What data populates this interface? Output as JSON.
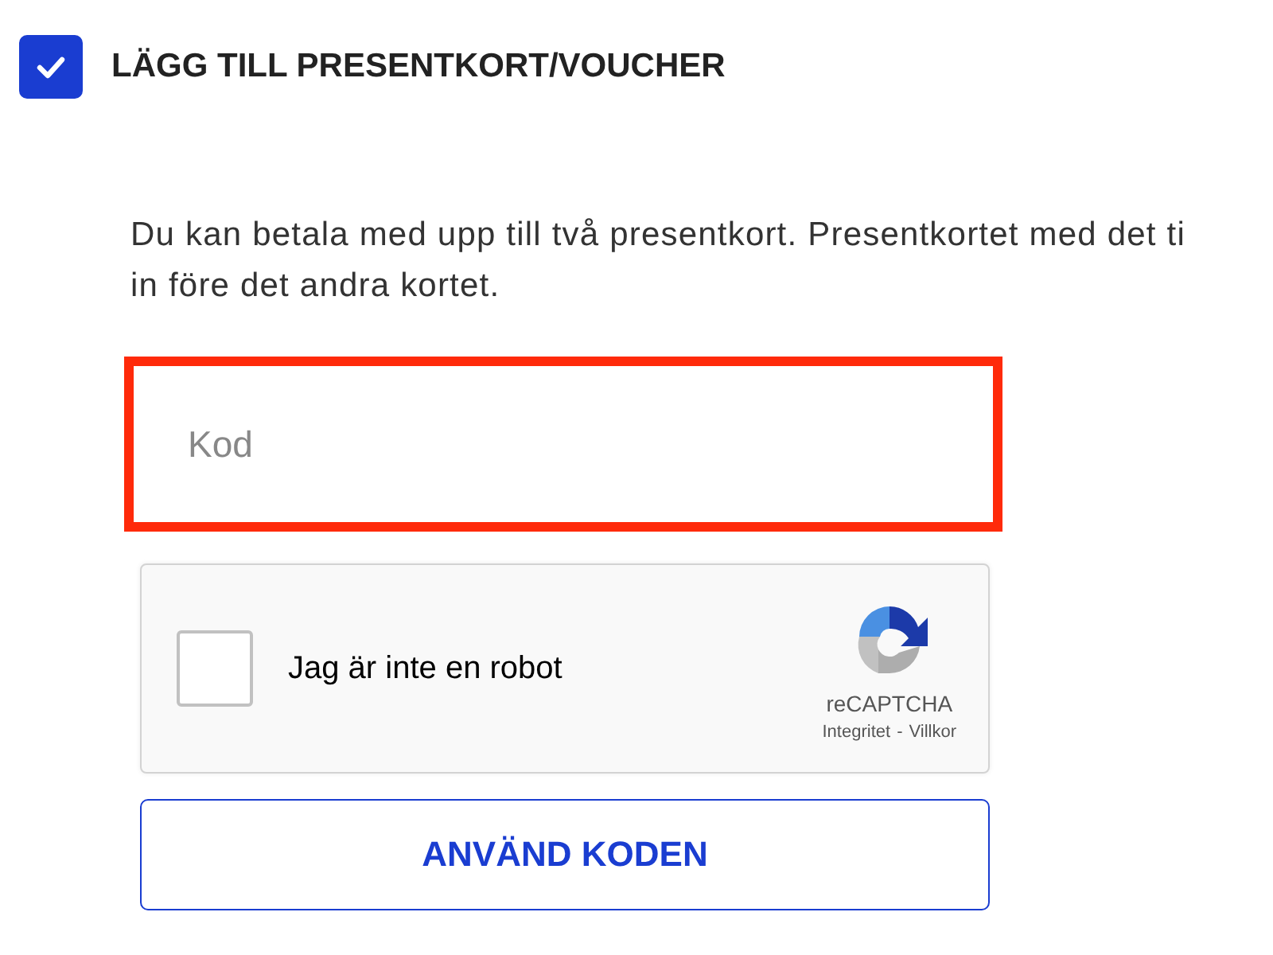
{
  "section": {
    "title": "LÄGG TILL PRESENTKORT/VOUCHER",
    "checked": true
  },
  "info": {
    "lines": [
      "Du kan betala med upp till två presentkort. Presentkortet med det ti",
      "in före det andra kortet."
    ]
  },
  "code_field": {
    "placeholder": "Kod",
    "error": true
  },
  "captcha": {
    "label": "Jag är inte en robot",
    "checked": false,
    "brand": "reCAPTCHA",
    "privacy": "Integritet",
    "separator": "-",
    "terms": "Villkor"
  },
  "buttons": [
    {
      "label": "ANVÄND KODEN"
    }
  ]
}
